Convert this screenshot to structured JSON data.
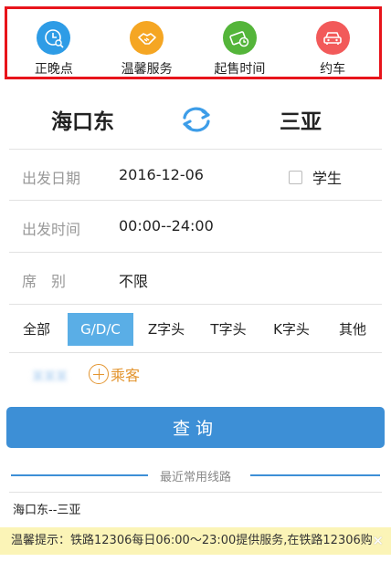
{
  "quick_links": [
    {
      "label": "正晚点",
      "icon": "clock-search-icon",
      "color": "#2e9ce6"
    },
    {
      "label": "温馨服务",
      "icon": "handshake-icon",
      "color": "#f5a623"
    },
    {
      "label": "起售时间",
      "icon": "ticket-clock-icon",
      "color": "#54b53a"
    },
    {
      "label": "约车",
      "icon": "car-icon",
      "color": "#f25a5a"
    }
  ],
  "route": {
    "from": "海口东",
    "to": "三亚",
    "swap_icon": "swap-arrows-icon"
  },
  "form": {
    "date_label": "出发日期",
    "date_value": "2016-12-06",
    "student_label": "学生",
    "time_label": "出发时间",
    "time_value": "00:00--24:00",
    "seat_label": "席　别",
    "seat_value": "不限"
  },
  "train_types": [
    {
      "label": "全部",
      "active": false
    },
    {
      "label": "G/D/C",
      "active": true
    },
    {
      "label": "Z字头",
      "active": false
    },
    {
      "label": "T字头",
      "active": false
    },
    {
      "label": "K字头",
      "active": false
    },
    {
      "label": "其他",
      "active": false
    }
  ],
  "passengers": {
    "blurred_name": "某某某",
    "add_label": "乘客"
  },
  "query_button": "查询",
  "recent": {
    "title": "最近常用线路",
    "items": [
      "海口东--三亚"
    ]
  },
  "notice": {
    "text": "温馨提示：铁路12306每日06:00～23:00提供服务,在铁路12306购",
    "close": "✕"
  },
  "colors": {
    "primary": "#3d8fd6",
    "active_tab": "#5aaee6",
    "accent_orange": "#e39530",
    "highlight_border": "#e8141b"
  }
}
